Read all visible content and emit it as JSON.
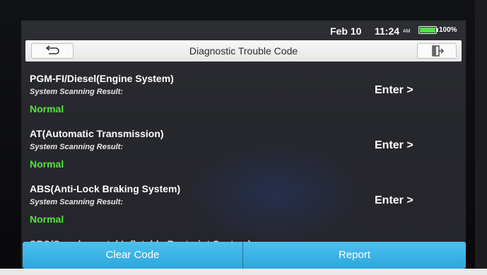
{
  "status_bar": {
    "date": "Feb 10",
    "time": "11:24",
    "ampm": "AM",
    "battery_percent": "100%",
    "battery_level": 1.0,
    "battery_color": "#4fe048"
  },
  "header": {
    "title": "Diagnostic Trouble Code",
    "back_icon": "back-arrow-icon",
    "exit_icon": "exit-door-icon"
  },
  "systems": [
    {
      "name": "PGM-FI/Diesel(Engine System)",
      "scan_label": "System Scanning Result:",
      "result": "Normal",
      "action": "Enter >"
    },
    {
      "name": "AT(Automatic Transmission)",
      "scan_label": "System Scanning Result:",
      "result": "Normal",
      "action": "Enter >"
    },
    {
      "name": "ABS(Anti-Lock Braking System)",
      "scan_label": "System Scanning Result:",
      "result": "Normal",
      "action": "Enter >"
    },
    {
      "name": "SRS(Supplemental Inflatable Restraint System)"
    }
  ],
  "actions": {
    "clear_code": "Clear Code",
    "report": "Report"
  },
  "colors": {
    "result_normal": "#53e33c",
    "action_button": "#3cb4e8",
    "screen_background": "#2a2b30"
  }
}
